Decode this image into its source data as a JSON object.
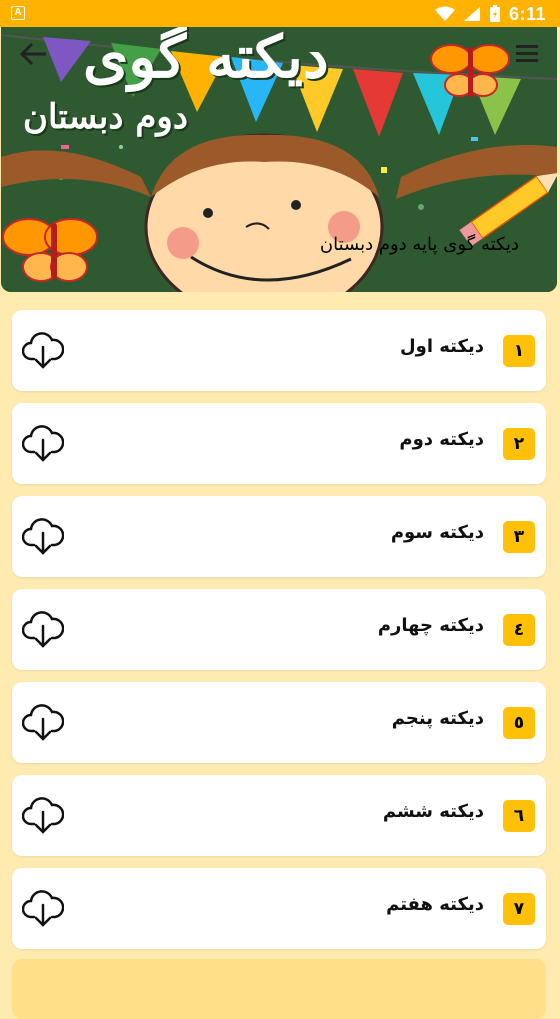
{
  "status_bar": {
    "time": "6:11",
    "app_icon_letter": "A"
  },
  "banner": {
    "title": "دیکته گوی",
    "subtitle": "دوم دبستان",
    "caption": "دیکته گوی پایه دوم دبستان"
  },
  "toolbar": {
    "back_icon": "arrow-left-icon",
    "menu_icon": "menu-icon"
  },
  "items": [
    {
      "number": "۱",
      "label": "دیکته اول"
    },
    {
      "number": "۲",
      "label": "دیکته دوم"
    },
    {
      "number": "۳",
      "label": "دیکته سوم"
    },
    {
      "number": "٤",
      "label": "دیکته چهارم"
    },
    {
      "number": "٥",
      "label": "دیکته پنجم"
    },
    {
      "number": "٦",
      "label": "دیکته ششم"
    },
    {
      "number": "۷",
      "label": "دیکته هفتم"
    }
  ],
  "colors": {
    "status_bar": "#ffb300",
    "background": "#ffebb0",
    "badge": "#ffc107"
  }
}
